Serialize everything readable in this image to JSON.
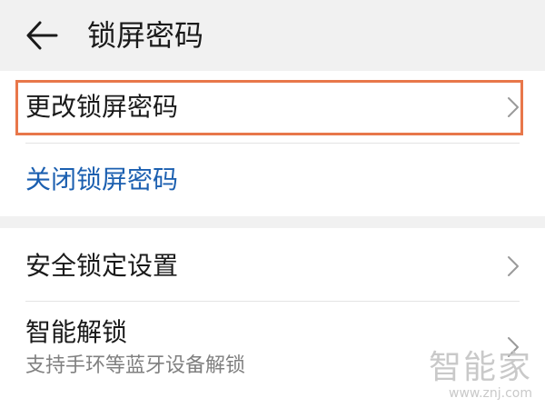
{
  "header": {
    "title": "锁屏密码",
    "back_icon": "arrow-left-icon"
  },
  "section1": {
    "change_password": {
      "label": "更改锁屏密码",
      "icon": "chevron-right-icon"
    },
    "disable_password": {
      "label": "关闭锁屏密码",
      "color": "#1b5fb0"
    }
  },
  "section2": {
    "security_lock": {
      "label": "安全锁定设置",
      "icon": "chevron-right-icon"
    },
    "smart_unlock": {
      "label": "智能解锁",
      "subtitle": "支持手环等蓝牙设备解锁",
      "icon": "chevron-right-icon"
    }
  },
  "colors": {
    "highlight": "#e8774a",
    "accent_link": "#1b5fb0",
    "background": "#f1f1f1"
  },
  "watermark": {
    "main": "智能家",
    "url": "www.znj.com"
  }
}
